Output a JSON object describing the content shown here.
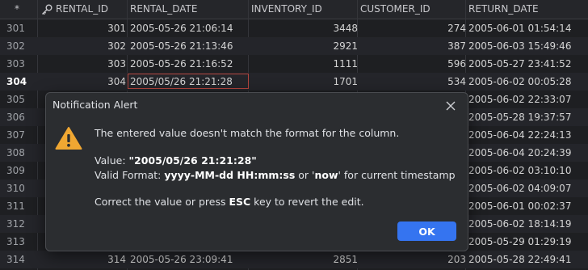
{
  "grid": {
    "corner": "*",
    "columns": [
      "RENTAL_ID",
      "RENTAL_DATE",
      "INVENTORY_ID",
      "CUSTOMER_ID",
      "RETURN_DATE"
    ],
    "rows": [
      {
        "num": "301",
        "rental_id": "301",
        "rental_date": "2005-05-26 21:06:14",
        "inventory_id": "3448",
        "customer_id": "274",
        "return_date": "2005-06-01 01:54:14"
      },
      {
        "num": "302",
        "rental_id": "302",
        "rental_date": "2005-05-26 21:13:46",
        "inventory_id": "2921",
        "customer_id": "387",
        "return_date": "2005-06-03 15:49:46"
      },
      {
        "num": "303",
        "rental_id": "303",
        "rental_date": "2005-05-26 21:16:52",
        "inventory_id": "1111",
        "customer_id": "596",
        "return_date": "2005-05-27 23:41:52"
      },
      {
        "num": "304",
        "rental_id": "304",
        "rental_date": "2005/05/26 21:21:28",
        "inventory_id": "1701",
        "customer_id": "534",
        "return_date": "2005-06-02 00:05:28"
      },
      {
        "num": "305",
        "rental_id": "",
        "rental_date": "",
        "inventory_id": "",
        "customer_id": "",
        "return_date": "2005-06-02 22:33:07"
      },
      {
        "num": "306",
        "rental_id": "",
        "rental_date": "",
        "inventory_id": "",
        "customer_id": "",
        "return_date": "2005-05-28 19:37:57"
      },
      {
        "num": "307",
        "rental_id": "",
        "rental_date": "",
        "inventory_id": "",
        "customer_id": "",
        "return_date": "2005-06-04 22:24:13"
      },
      {
        "num": "308",
        "rental_id": "",
        "rental_date": "",
        "inventory_id": "",
        "customer_id": "",
        "return_date": "2005-06-04 20:24:39"
      },
      {
        "num": "309",
        "rental_id": "",
        "rental_date": "",
        "inventory_id": "",
        "customer_id": "",
        "return_date": "2005-06-02 03:10:10"
      },
      {
        "num": "310",
        "rental_id": "",
        "rental_date": "",
        "inventory_id": "",
        "customer_id": "",
        "return_date": "2005-06-02 04:09:07"
      },
      {
        "num": "311",
        "rental_id": "",
        "rental_date": "",
        "inventory_id": "",
        "customer_id": "",
        "return_date": "2005-06-01 00:02:37"
      },
      {
        "num": "312",
        "rental_id": "",
        "rental_date": "",
        "inventory_id": "",
        "customer_id": "",
        "return_date": "2005-06-02 18:14:19"
      },
      {
        "num": "313",
        "rental_id": "",
        "rental_date": "",
        "inventory_id": "",
        "customer_id": "",
        "return_date": "2005-05-29 01:29:19"
      },
      {
        "num": "314",
        "rental_id": "314",
        "rental_date": "2005-05-26 23:09:41",
        "inventory_id": "2851",
        "customer_id": "203",
        "return_date": "2005-05-28 22:49:41"
      }
    ],
    "active_row": "304",
    "key_icon": "key-icon"
  },
  "dialog": {
    "title": "Notification Alert",
    "message": "The entered value doesn't match the format for the column.",
    "value_label": "Value: ",
    "value": "\"2005/05/26 21:21:28\"",
    "format_label": "Valid Format: ",
    "format": "yyyy-MM-dd HH:mm:ss",
    "format_or": " or '",
    "now": "now",
    "format_tail": "' for current timestamp",
    "hint_pre": "Correct the value or press ",
    "hint_key": "ESC",
    "hint_post": " key to revert the edit.",
    "ok_label": "OK",
    "icons": {
      "close": "close-icon",
      "warning": "warning-icon"
    },
    "colors": {
      "accent": "#3574f0",
      "warning": "#f0a732",
      "edit_border": "#b2453e"
    }
  }
}
